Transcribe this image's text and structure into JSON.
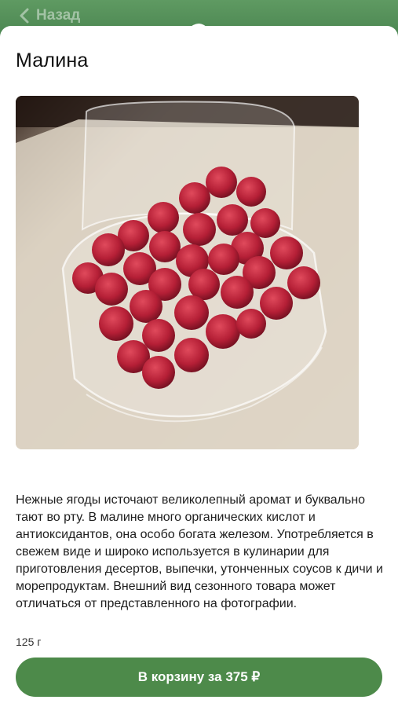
{
  "header": {
    "back_label": "Назад"
  },
  "product": {
    "title": "Малина",
    "image_icon": "raspberries-photo",
    "description": "Нежные ягоды источают великолепный аромат и буквально тают во рту. В малине много органических кислот и антиоксидантов, она особо богата железом. Употребляется в свежем виде и широко используется в кулинарии для приготовления десертов, выпечки, утонченных соусов к дичи и морепродуктам. Внешний вид сезонного товара может отличаться от представленного на фотографии.",
    "weight": "125 г"
  },
  "cart": {
    "button_label": "В корзину за 375 ₽"
  },
  "colors": {
    "accent": "#4d8a4a",
    "background_green": "#4e8a54",
    "berry": "#c0283e"
  }
}
